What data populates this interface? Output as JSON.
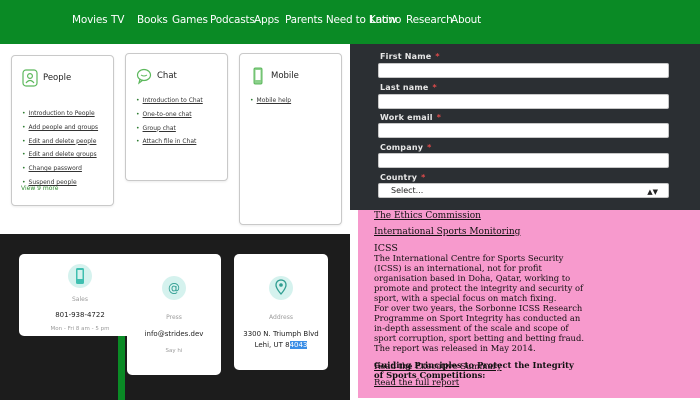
{
  "nav": {
    "items": [
      "Movies",
      "TV",
      "Books",
      "Games",
      "Podcasts",
      "Apps",
      "Parents Need to Know",
      "Latino",
      "Research",
      "About"
    ]
  },
  "help_cards": [
    {
      "title": "People",
      "icon": "people-icon",
      "links": [
        "Introduction to People",
        "Add people and groups",
        "Edit and delete people",
        "Edit and delete groups",
        "Change password",
        "Suspend people"
      ],
      "more": "View 9 more"
    },
    {
      "title": "Chat",
      "icon": "chat-icon",
      "links": [
        "Introduction to Chat",
        "One-to-one chat",
        "Group chat",
        "Attach file in Chat"
      ]
    },
    {
      "title": "Mobile",
      "icon": "mobile-icon",
      "links": [
        "Mobile help"
      ]
    }
  ],
  "contacts": [
    {
      "label": "Sales",
      "value": "801-938-4722",
      "sub": "Mon - Fri 8 am - 5 pm",
      "icon": "phone-icon"
    },
    {
      "label": "Press",
      "value": "info@strides.dev",
      "sub": "Say hi",
      "icon": "at-sign-icon"
    },
    {
      "label": "Address",
      "value_line1": "3300 N. Triumph Blvd",
      "value_line2_prefix": "Lehi, UT 8",
      "value_line2_selected": "4043",
      "icon": "location-pin-icon"
    }
  ],
  "form": {
    "fields": [
      {
        "label": "First Name",
        "required": "*",
        "value": ""
      },
      {
        "label": "Last name",
        "required": "*",
        "value": ""
      },
      {
        "label": "Work email",
        "required": "*",
        "value": ""
      },
      {
        "label": "Company",
        "required": "*",
        "value": ""
      },
      {
        "label": "Country",
        "required": "*",
        "value": "Select..."
      }
    ]
  },
  "article": {
    "link1": "The Ethics Commission",
    "link2": "International Sports Monitoring",
    "heading": "ICSS",
    "paragraph": [
      "The International Centre for Sports Security",
      "(ICSS) is an international, not for profit",
      "organisation based in Doha, Qatar, working to",
      "promote and protect the integrity and security of",
      "sport, with a special focus on match fixing.",
      "For over two years, the Sorbonne ICSS Research",
      "Programme on Sport Integrity has conducted an",
      "in-depth assessment of the scale and scope of",
      "sport corruption, sport betting and betting fraud.",
      "The report was released in May 2014."
    ],
    "guiding": [
      "Guiding Principles to Protect the Integrity",
      "of Sports Competitions:"
    ],
    "link3": "Read the Executive Summary",
    "link4": "Read the full report"
  },
  "colors": {
    "nav_green": "#0a8a25",
    "dark_panel": "#2b2f33",
    "pink_panel": "#f79acd",
    "accent_teal": "#d5f2ee",
    "required_red": "#e04b4b"
  }
}
